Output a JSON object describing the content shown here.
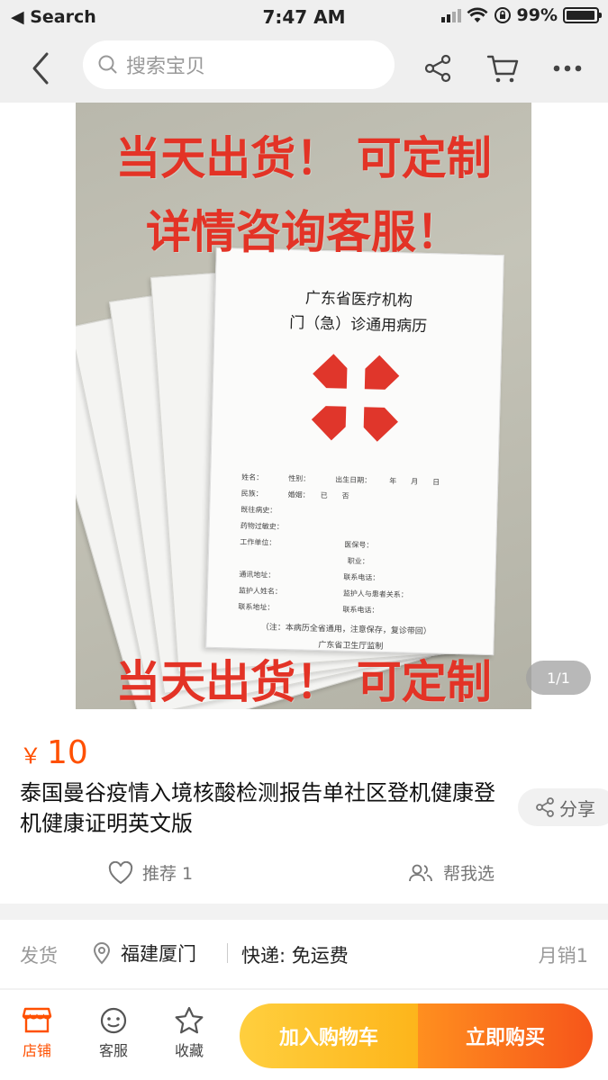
{
  "status_bar": {
    "back_app": "◀ Search",
    "time": "7:47 AM",
    "battery": "99%",
    "battery_level": 0.99
  },
  "nav": {
    "search_placeholder": "搜索宝贝",
    "icons": [
      "back-chevron-icon",
      "search-icon",
      "share-icon",
      "cart-icon",
      "more-icon"
    ]
  },
  "product_image": {
    "promo_top_1": "当天出货！ 可定制",
    "promo_top_2": "详情咨询客服！",
    "promo_bottom": "当天出货！ 可定制",
    "doc_title_1": "广东省医疗机构",
    "doc_title_2": "门（急）诊通用病历",
    "form": {
      "r1": "姓名：　　　　性别：　　　　出生日期：　　　年　　月　　日",
      "r2": "民族：　　　　婚姻：　　已　　否",
      "r3": "既往病史：",
      "r4": "药物过敏史：",
      "r5": "工作单位：　　　　　　　　　　医保号：",
      "r6": "　　　　　　　　　　　　　　　职业：",
      "r7": "通讯地址：　　　　　　　　　　联系电话：",
      "r8": "监护人姓名：　　　　　　　　　监护人与患者关系：",
      "r9": "联系地址：　　　　　　　　　　联系电话：",
      "r10": "（注：本病历全省通用，注意保存，复诊带回）",
      "r11": "广东省卫生厅监制"
    },
    "counter": "1/1"
  },
  "product": {
    "currency": "￥",
    "price": "10",
    "title": "泰国曼谷疫情入境核酸检测报告单社区登机健康登机健康证明英文版",
    "share_label": "分享",
    "recommend_label": "推荐 1",
    "help_choose_label": "帮我选"
  },
  "shipping": {
    "label": "发货",
    "location": "福建厦门",
    "express": "快递: 免运费",
    "monthly_sales": "月销1"
  },
  "bottom_bar": {
    "store": "店铺",
    "service": "客服",
    "favorite": "收藏",
    "add_to_cart": "加入购物车",
    "buy_now": "立即购买"
  },
  "colors": {
    "accent": "#ff5000",
    "promo_red": "#e33326",
    "cart_yellow": "#ffc02d",
    "buy_orange": "#f6551a"
  }
}
